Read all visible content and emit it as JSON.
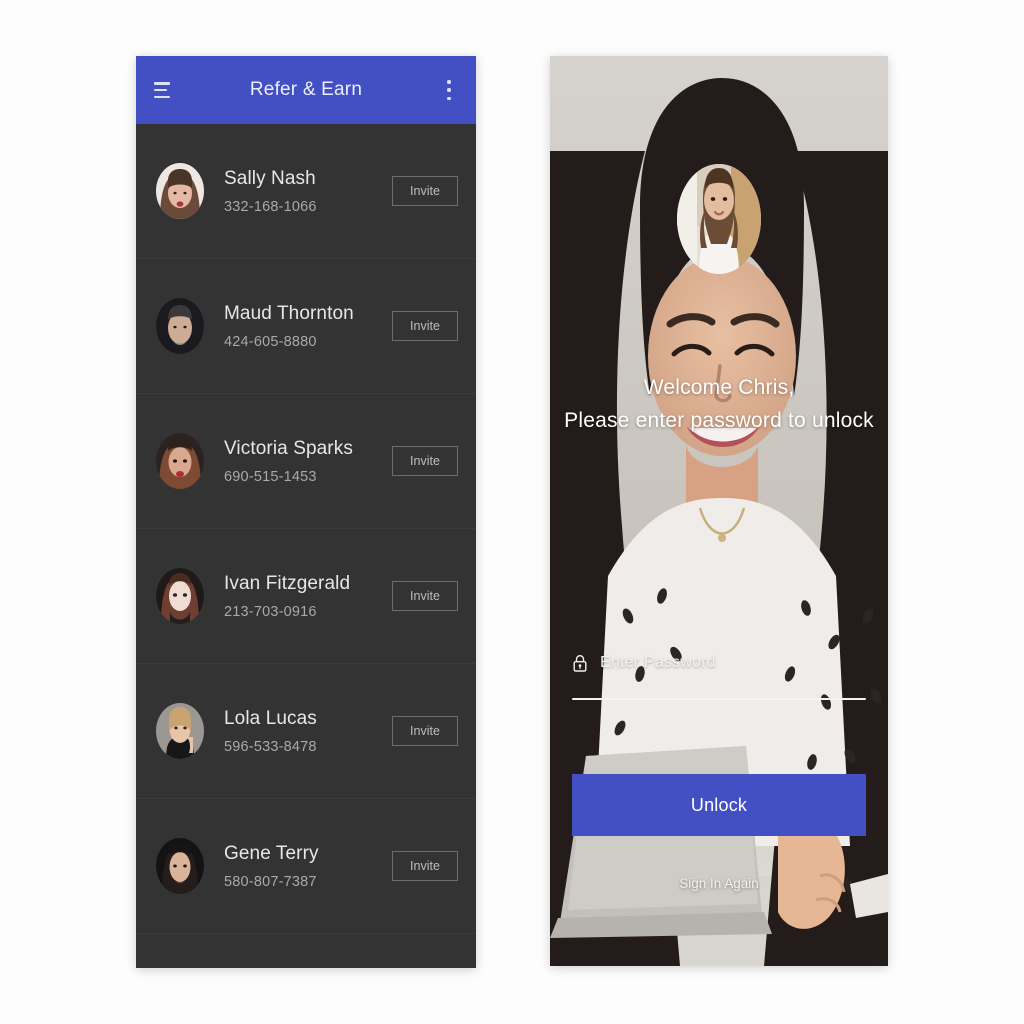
{
  "left_phone": {
    "appbar": {
      "menu_icon": "hamburger-icon",
      "title": "Refer & Earn",
      "overflow_icon": "kebab-menu-icon"
    },
    "accent_color": "#4350c4",
    "surface_color": "#333333",
    "contacts": [
      {
        "name": "Sally Nash",
        "phone": "332-168-1066",
        "action": "Invite"
      },
      {
        "name": "Maud Thornton",
        "phone": "424-605-8880",
        "action": "Invite"
      },
      {
        "name": "Victoria Sparks",
        "phone": "690-515-1453",
        "action": "Invite"
      },
      {
        "name": "Ivan Fitzgerald",
        "phone": "213-703-0916",
        "action": "Invite"
      },
      {
        "name": "Lola Lucas",
        "phone": "596-533-8478",
        "action": "Invite"
      },
      {
        "name": "Gene Terry",
        "phone": "580-807-7387",
        "action": "Invite"
      }
    ]
  },
  "right_phone": {
    "avatar_name": "user-avatar",
    "welcome_line_1": "Welcome Chris,",
    "welcome_line_2": "Please enter password to unlock",
    "password": {
      "icon": "lock-icon",
      "placeholder": "Enter Password",
      "value": ""
    },
    "unlock_label": "Unlock",
    "sign_in_again_label": "Sign In Again",
    "accent_color": "#4350c4"
  }
}
